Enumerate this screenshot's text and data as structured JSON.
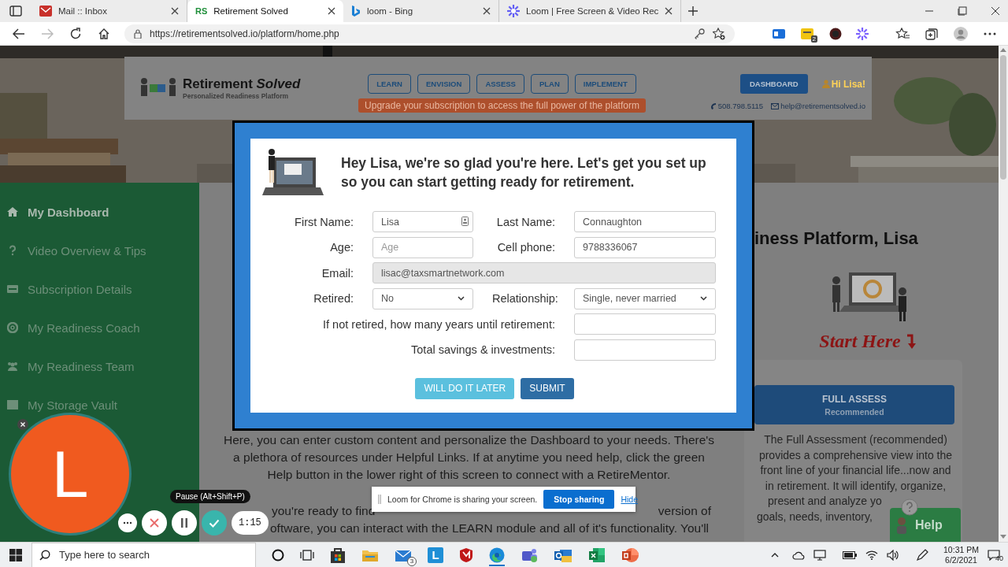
{
  "browser": {
    "tabs": [
      {
        "title": "Mail :: Inbox",
        "selected": false,
        "kind": "mail"
      },
      {
        "title": "Retirement Solved",
        "selected": true,
        "kind": "letters",
        "icon_text": "RS"
      },
      {
        "title": "loom - Bing",
        "selected": false,
        "kind": "search"
      },
      {
        "title": "Loom | Free Screen & Video Rec",
        "selected": false,
        "kind": "recorder"
      }
    ],
    "url": "https://retirementsolved.io/platform/home.php",
    "extension_badge": "2"
  },
  "header": {
    "brand": "Retirement *Solved*",
    "tagline": "Personalized Readiness Platform",
    "nav": [
      "LEARN",
      "ENVISION",
      "ASSESS",
      "PLAN",
      "IMPLEMENT"
    ],
    "upgrade_banner": "Upgrade your subscription to access the full power of the platform",
    "dashboard_button": "DASHBOARD",
    "greeting": "Hi Lisa!",
    "phone": "508.798.5115",
    "email": "help@retirementsolved.io"
  },
  "sidebar": {
    "items": [
      {
        "label": "My Dashboard",
        "kind": "home",
        "selected": true
      },
      {
        "label": "Video Overview & Tips",
        "kind": "question",
        "selected": false
      },
      {
        "label": "Subscription Details",
        "kind": "card",
        "selected": false
      },
      {
        "label": "My Readiness Coach",
        "kind": "lifebuoy",
        "selected": false
      },
      {
        "label": "My Readiness Team",
        "kind": "users",
        "selected": false
      },
      {
        "label": "My Storage Vault",
        "kind": "archive",
        "selected": false
      }
    ]
  },
  "main": {
    "paragraph": "Here, you can enter custom content and personalize the Dashboard to your needs. There's a plethora of resources under Helpful Links. If at anytime you need help, click the green Help button in the lower right of this screen to connect with a RetireMentor.",
    "partly_covered_lines": [
      [
        "you're ready to find",
        "version of"
      ],
      [
        "oftware, you can interact with the LEARN module and all of it's functionality. You'll"
      ]
    ]
  },
  "right": {
    "heading": "iness Platform, Lisa",
    "start_here": "Start Here",
    "card_button": {
      "title": "FULL ASSESS",
      "subtitle": "Recommended"
    },
    "card_text_lines": [
      "The Full Assessment (recommended)",
      "provides a comprehensive view into the",
      "front line of your financial life...now and",
      "in retirement. It will identify, organize,",
      "present and analyze yo",
      "goals, needs, inventory,"
    ]
  },
  "help_button": "Help",
  "modal": {
    "heading": "Hey Lisa, we're so glad you're here. Let's get you set up so you can start getting ready for retirement.",
    "rows": [
      [
        {
          "kind": "text",
          "label": "First Name:",
          "value": "Lisa",
          "autofill": true,
          "disabled": false
        },
        {
          "kind": "text",
          "label": "Last Name:",
          "value": "Connaughton",
          "autofill": false,
          "disabled": false
        }
      ],
      [
        {
          "kind": "text",
          "label": "Age:",
          "placeholder": "Age",
          "autofill": false,
          "disabled": false
        },
        {
          "kind": "text",
          "label": "Cell phone:",
          "value": "9788336067",
          "autofill": false,
          "disabled": false
        }
      ],
      [
        {
          "kind": "text",
          "label": "Email:",
          "value": "lisac@taxsmartnetwork.com",
          "autofill": false,
          "disabled": true
        }
      ],
      [
        {
          "kind": "select",
          "label": "Retired:",
          "value": "No"
        },
        {
          "kind": "select",
          "label": "Relationship:",
          "value": "Single, never married"
        }
      ],
      [
        {
          "kind": "question",
          "label": "If not retired, how many years until retirement:"
        }
      ],
      [
        {
          "kind": "question",
          "label": "Total savings & investments:"
        }
      ]
    ],
    "buttons": [
      {
        "label": "WILL DO IT LATER",
        "kind": "secondary"
      },
      {
        "label": "SUBMIT",
        "kind": "primary"
      }
    ]
  },
  "loom": {
    "initial": "L",
    "tooltip": "Pause (Alt+Shift+P)",
    "timer": "1:15"
  },
  "share_bar": {
    "message": "Loom for Chrome is sharing your screen.",
    "stop_button": "Stop sharing",
    "hide_link": "Hide"
  },
  "taskbar": {
    "search_placeholder": "Type here to search",
    "mail_badge": "3",
    "app_letter": "L",
    "time": "10:31 PM",
    "date": "6/2/2021",
    "notification_count": "40"
  }
}
